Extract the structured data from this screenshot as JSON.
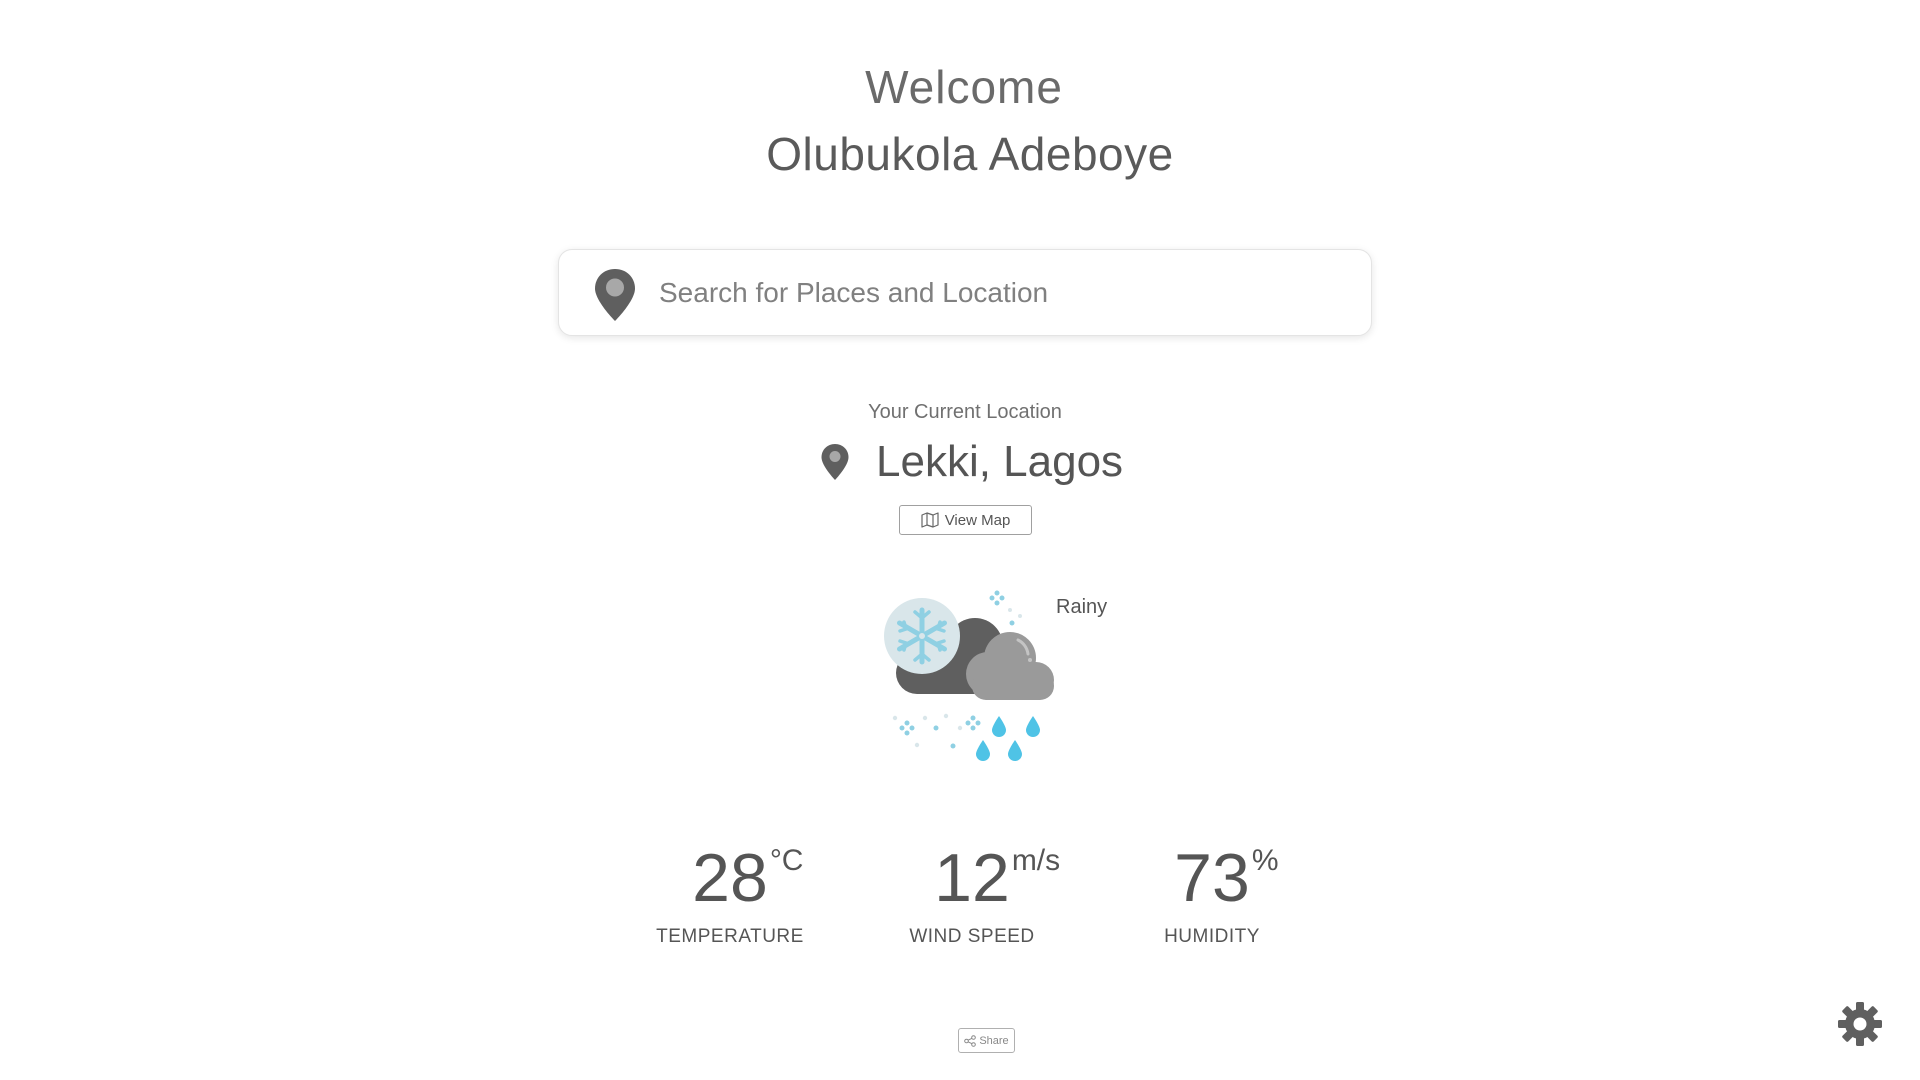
{
  "header": {
    "welcome": "Welcome",
    "user_name": "Olubukola Adeboye"
  },
  "search": {
    "placeholder": "Search for Places and Location",
    "value": ""
  },
  "location": {
    "label": "Your Current Location",
    "name": "Lekki, Lagos",
    "view_map_label": "View Map"
  },
  "weather": {
    "condition": "Rainy",
    "icon": "snow-rain-cloud-icon"
  },
  "stats": {
    "temperature": {
      "value": "28",
      "unit": "°C",
      "label": "TEMPERATURE"
    },
    "wind": {
      "value": "12",
      "unit": "m/s",
      "label": "WIND SPEED"
    },
    "humidity": {
      "value": "73",
      "unit": "%",
      "label": "HUMIDITY"
    }
  },
  "footer": {
    "share_label": "Share"
  },
  "colors": {
    "text": "#555555",
    "icon_gray": "#5f5f5f",
    "cloud_light": "#9a9a9a",
    "snow_circle": "#d9e6ea",
    "snow_blue": "#8fd0e3",
    "rain_blue": "#4fc3e6"
  }
}
